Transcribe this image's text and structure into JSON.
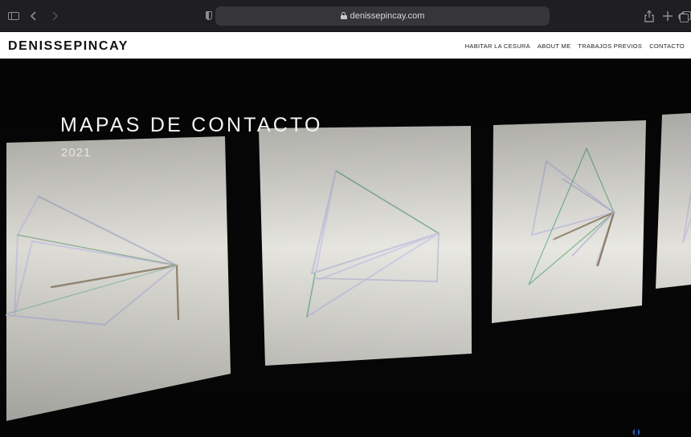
{
  "browser": {
    "url": "denissepincay.com",
    "icons": {
      "sidebar": "sidebar-icon",
      "back": "chevron-left-icon",
      "forward": "chevron-right-icon",
      "privacy": "shield-icon",
      "lock": "lock-icon",
      "reload": "reload-icon",
      "share": "share-icon",
      "new_tab": "plus-icon",
      "tabs": "tabs-icon"
    }
  },
  "site": {
    "brand": "DENISSEPINCAY",
    "nav": [
      "HABITAR LA CESURA",
      "ABOUT ME",
      "TRABAJOS PREVIOS",
      "CONTACTO"
    ]
  },
  "hero": {
    "title": "MAPAS DE CONTACTO",
    "year": "2021"
  },
  "colors": {
    "chrome": "#1f1f21",
    "address_bar": "#36363a",
    "hero_background": "#070707",
    "card": "#e3e2dc",
    "text_light": "#f4f4f4"
  }
}
